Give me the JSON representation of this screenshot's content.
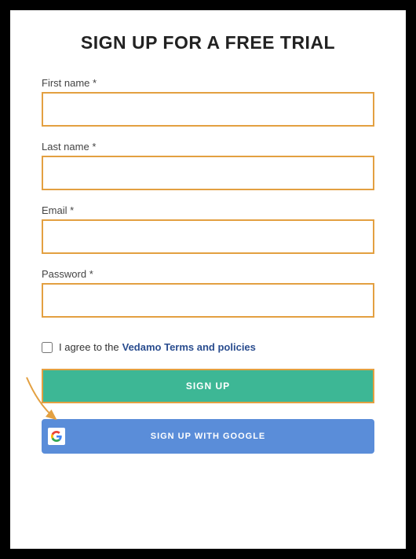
{
  "title": "SIGN UP FOR A FREE TRIAL",
  "fields": {
    "firstName": {
      "label": "First name *",
      "value": ""
    },
    "lastName": {
      "label": "Last name *",
      "value": ""
    },
    "email": {
      "label": "Email *",
      "value": ""
    },
    "password": {
      "label": "Password *",
      "value": ""
    }
  },
  "agree": {
    "prefix": "I agree to the",
    "linkText": "Vedamo Terms and policies",
    "checked": false
  },
  "buttons": {
    "signup": "SIGN UP",
    "google": "SIGN UP WITH GOOGLE"
  },
  "colors": {
    "inputBorder": "#e3a041",
    "primaryBtn": "#3db795",
    "googleBtn": "#5a8dd9",
    "link": "#2a4d8f"
  }
}
